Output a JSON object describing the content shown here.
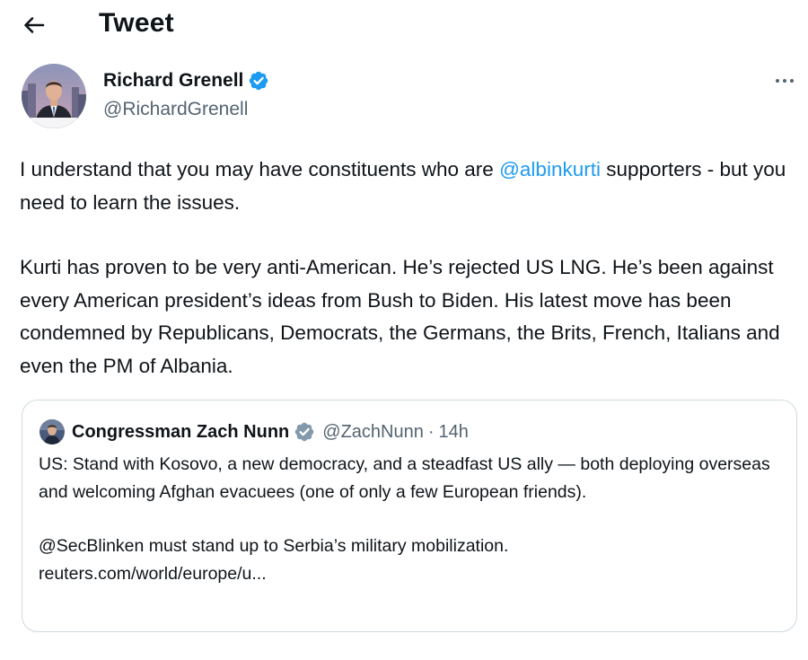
{
  "header": {
    "title": "Tweet"
  },
  "tweet": {
    "author": {
      "name": "Richard Grenell",
      "handle": "@RichardGrenell"
    },
    "paragraph1": {
      "before": "I understand that you may have constituents who are ",
      "mention": "@albinkurti",
      "after": " supporters - but you need to learn the issues."
    },
    "paragraph2": "Kurti has proven to be very anti-American. He’s rejected US LNG. He’s been against every American president’s ideas from Bush to Biden. His latest move has been condemned by Republicans, Democrats, the Germans, the Brits, French, Italians and even the PM of Albania."
  },
  "quoted_tweet": {
    "author_name": "Congressman Zach Nunn",
    "handle": "@ZachNunn",
    "separator": "·",
    "time": "14h",
    "paragraph1": "US: Stand with Kosovo, a new democracy, and a steadfast US ally — both deploying overseas and welcoming Afghan evacuees (one of only a few European friends).",
    "paragraph2": "@SecBlinken must stand up to Serbia’s military mobilization.",
    "link": "reuters.com/world/europe/u..."
  },
  "icons": {
    "back": "arrow-left-icon",
    "verified": "verified-badge-icon",
    "more": "more-horizontal-icon"
  },
  "colors": {
    "accent": "#1d9bf0",
    "text_primary": "#0f1419",
    "text_secondary": "#536471",
    "border": "#cfd9de"
  }
}
